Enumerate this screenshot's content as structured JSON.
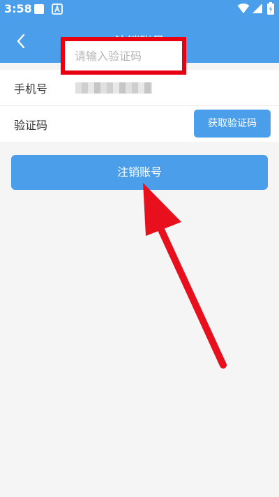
{
  "status_bar": {
    "time": "3:58",
    "icons": [
      "notification-square-icon",
      "font-a-icon",
      "wifi-icon",
      "signal-icon",
      "battery-icon"
    ]
  },
  "nav": {
    "title": "注销账号",
    "back_icon": "chevron-left-icon"
  },
  "form": {
    "phone_label": "手机号",
    "phone_value": "",
    "code_label": "验证码",
    "code_placeholder": "请输入验证码",
    "code_value": "",
    "get_code_label": "获取验证码"
  },
  "submit_label": "注销账号",
  "colors": {
    "primary": "#4a9eea",
    "highlight_box": "#e60012",
    "arrow": "#e8101c",
    "background": "#f5f5f5"
  }
}
